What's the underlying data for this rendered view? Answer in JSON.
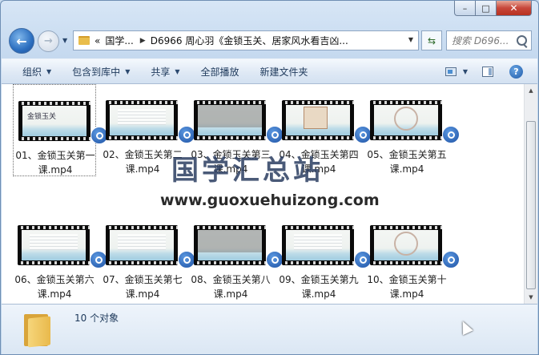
{
  "window": {
    "caption_buttons": [
      "–",
      "□",
      "✕"
    ]
  },
  "nav": {
    "address_parts": [
      "«",
      "国学...",
      "D6966 周心羽《金锁玉关、居家风水看吉凶..."
    ],
    "search_placeholder": "搜索 D696..."
  },
  "toolbar": {
    "items": [
      "组织",
      "包含到库中",
      "共享",
      "全部播放",
      "新建文件夹"
    ]
  },
  "files": [
    {
      "label": "01、金锁玉关第一课.mp4",
      "selected": true
    },
    {
      "label": "02、金锁玉关第二课.mp4"
    },
    {
      "label": "03、金锁玉关第三课.mp4"
    },
    {
      "label": "04、金锁玉关第四课.mp4"
    },
    {
      "label": "05、金锁玉关第五课.mp4"
    },
    {
      "label": "06、金锁玉关第六课.mp4"
    },
    {
      "label": "07、金锁玉关第七课.mp4"
    },
    {
      "label": "08、金锁玉关第八课.mp4"
    },
    {
      "label": "09、金锁玉关第九课.mp4"
    },
    {
      "label": "10、金锁玉关第十课.mp4"
    }
  ],
  "watermark": {
    "title": "国学汇总站",
    "url": "www.guoxuehuizong.com"
  },
  "status": {
    "count_text": "10 个对象"
  },
  "thumb_seal_text": "金锁玉关",
  "colors": {
    "accent": "#1c50a3",
    "toolbar_text": "#1e395b",
    "close_button": "#c7473a"
  }
}
